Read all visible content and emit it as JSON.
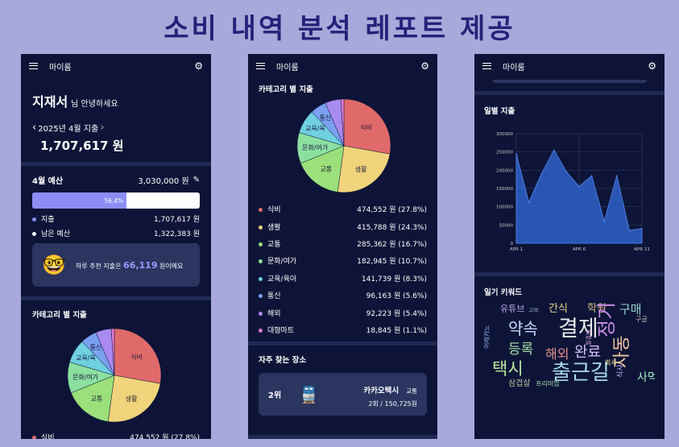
{
  "banner": {
    "title": "소비 내역 분석 레포트 제공"
  },
  "app": {
    "name": "마이룸"
  },
  "home": {
    "user_name": "지재서",
    "greeting": "님 안녕하세요",
    "month_label": "2025년 4월 지출",
    "total": "1,707,617 원",
    "budget_label": "4월 예산",
    "budget_value": "3,030,000 원",
    "budget_used_percent": 56.4,
    "budget_used_label": "56.4%",
    "spend_label": "지출",
    "spend_value": "1,707,617 원",
    "remain_label": "남은 예산",
    "remain_value": "1,322,383 원",
    "recommend_prefix": "하루 추천 지출은",
    "recommend_value": "66,119",
    "recommend_suffix": "원이에요",
    "category_title": "카테고리 별 지출",
    "first_row_name": "식비",
    "first_row_value": "474,552 원 (27.8%)"
  },
  "categories": {
    "title": "카테고리 별 지출",
    "pie_labels": [
      "식비",
      "생활",
      "교통",
      "문화/여가",
      "교육/육",
      "통신"
    ],
    "rows": [
      {
        "name": "식비",
        "value": "474,552 원 (27.8%)",
        "color": "#e06a6a"
      },
      {
        "name": "생활",
        "value": "415,788 원 (24.3%)",
        "color": "#f0d37a"
      },
      {
        "name": "교통",
        "value": "285,362 원 (16.7%)",
        "color": "#9be07a"
      },
      {
        "name": "문화/여가",
        "value": "182,945 원 (10.7%)",
        "color": "#8be0a0"
      },
      {
        "name": "교육/육아",
        "value": "141,739 원 (8.3%)",
        "color": "#6fd0e0"
      },
      {
        "name": "통신",
        "value": "96,163 원 (5.6%)",
        "color": "#7aa0f0"
      },
      {
        "name": "해외",
        "value": "92,223 원 (5.4%)",
        "color": "#a98af0"
      },
      {
        "name": "대형마트",
        "value": "18,845 원 (1.1%)",
        "color": "#e07ad0"
      }
    ],
    "pie_slices": [
      27.8,
      24.3,
      16.7,
      10.7,
      8.3,
      5.6,
      5.4,
      1.1
    ],
    "frequent_title": "자주 찾는 장소",
    "place_rank": "2위",
    "place_name": "카카오택시",
    "place_tag": "교통",
    "place_stats": "2회 / 150,725원"
  },
  "daily": {
    "title": "일별 지출",
    "chart_data": {
      "type": "area",
      "title": "",
      "x_ticks": [
        "APR 1",
        "APR 6",
        "APR 11"
      ],
      "y_ticks": [
        "0",
        "50000",
        "100000",
        "150000",
        "200000",
        "250000",
        "300000"
      ],
      "ylim": [
        0,
        300000
      ],
      "x": [
        1,
        2,
        3,
        4,
        5,
        6,
        7,
        8,
        9,
        10,
        11
      ],
      "values": [
        245000,
        112000,
        190000,
        255000,
        195000,
        155000,
        185000,
        60000,
        185000,
        35000,
        40000
      ],
      "color": "#2f62c9"
    },
    "keyword_title": "일기 키워드",
    "keywords": [
      "유튜브",
      "간식",
      "학원",
      "구매",
      "고보",
      "약속",
      "결제",
      "정기",
      "등록",
      "택시",
      "해외",
      "완료",
      "출근길",
      "자동",
      "삼겹살",
      "프리미엄",
      "어레카노",
      "구글",
      "월결제",
      "사먹",
      "회사",
      "식사"
    ]
  }
}
